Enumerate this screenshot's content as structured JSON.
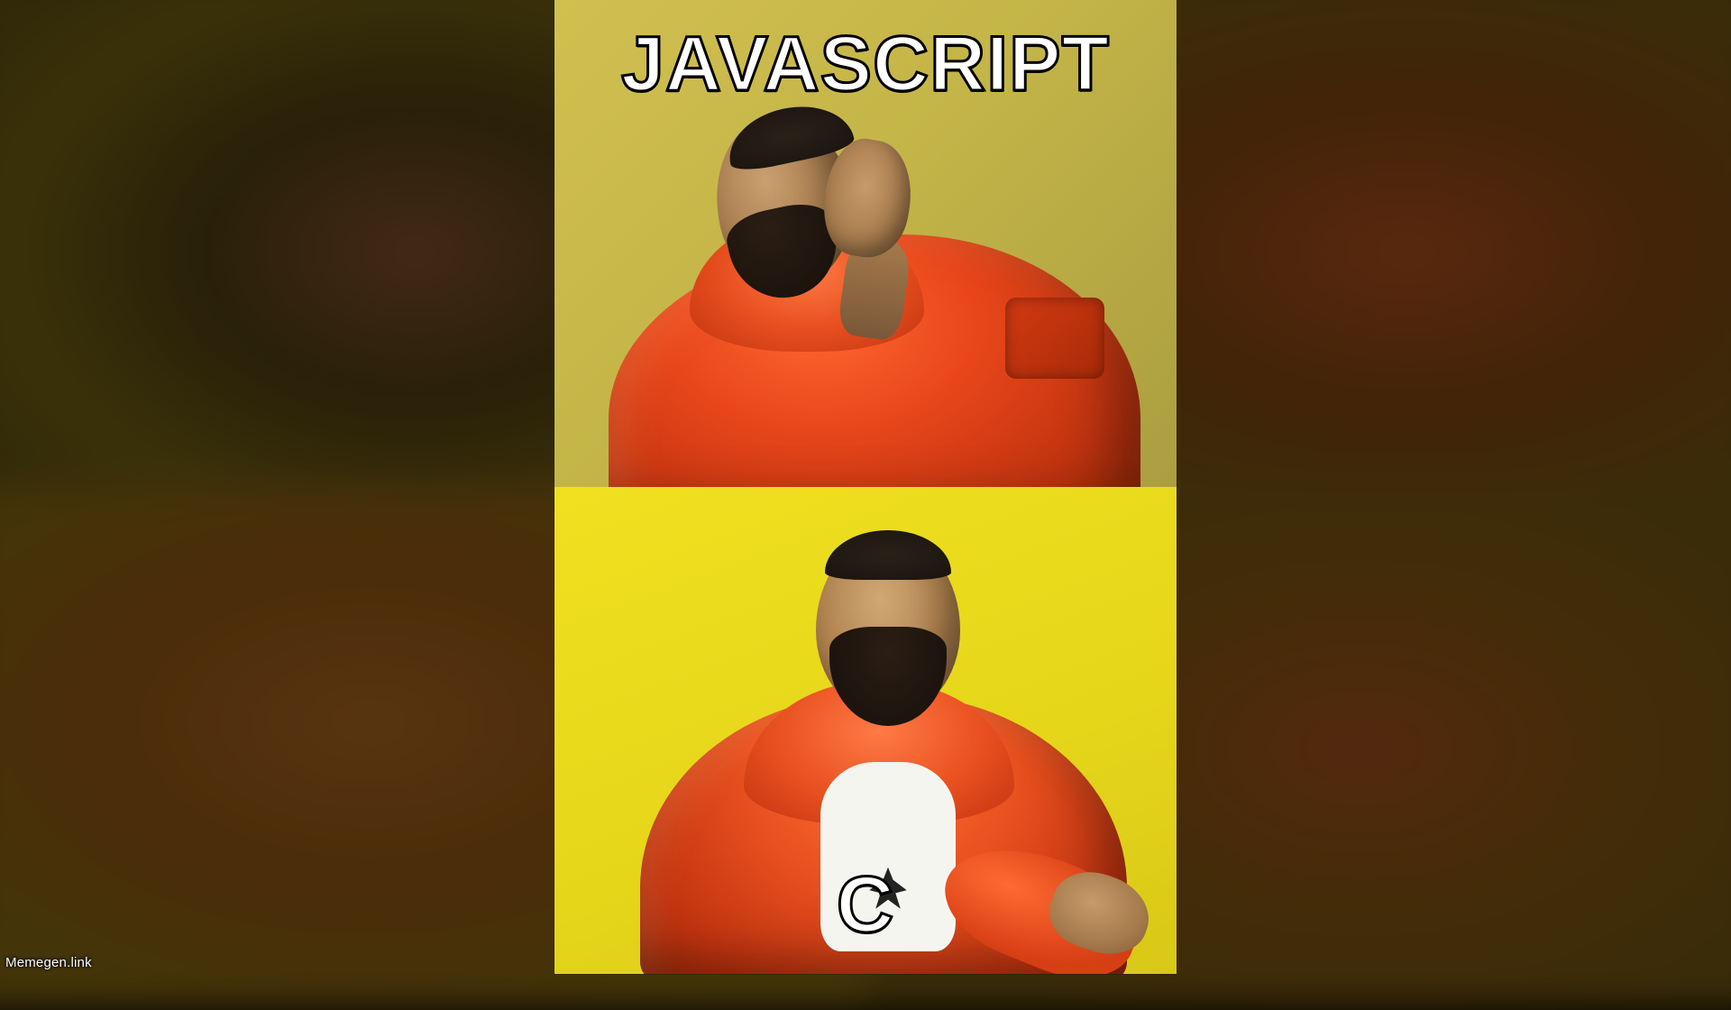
{
  "meme": {
    "template": "drake-hotline-bling",
    "top_text": "JAVASCRIPT",
    "bottom_text": "C"
  },
  "watermark": "Memegen.link"
}
